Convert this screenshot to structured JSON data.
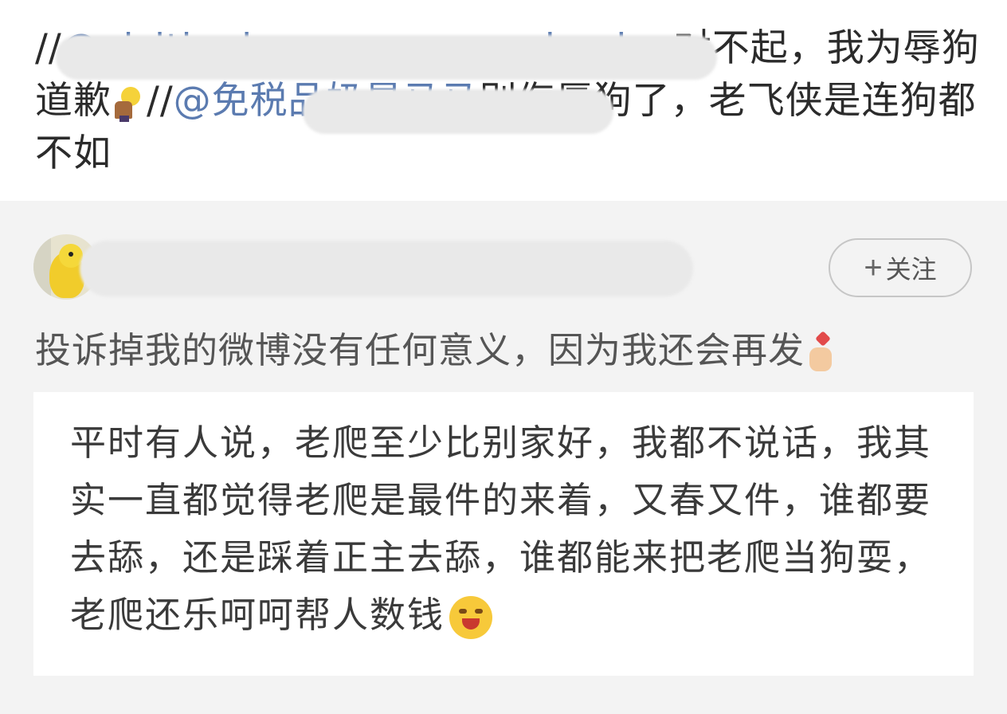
{
  "top_post": {
    "prefix": "//",
    "mention_1": "@visitinghourswereoverdayday",
    "text_1": "对不起，我为辱狗道歉",
    "bulb_emoji": "person-with-lightbulb-emoji",
    "separator": "//",
    "mention_2": "@免税品奶是马马",
    "text_2": "别侮辱狗了，老飞侠是连狗都不如"
  },
  "repost": {
    "username": "visitinghourswereoverdayday",
    "follow_label": "关注",
    "follow_icon": "+",
    "text": "投诉掉我的微博没有任何意义，因为我还会再发",
    "hand_emoji": "finger-heart-emoji",
    "quote": "平时有人说，老爬至少比别家好，我都不说话，我其实一直都觉得老爬是最件的来着，又春又件，谁都要去舔，还是踩着正主去舔，谁都能来把老爬当狗耍，老爬还乐呵呵帮人数钱",
    "face_emoji": "drooling-bleeding-face-emoji"
  }
}
